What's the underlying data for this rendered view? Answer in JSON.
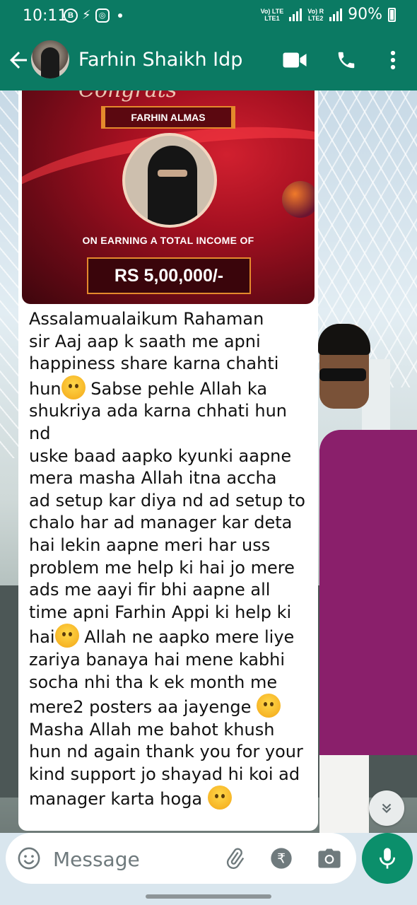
{
  "status_bar": {
    "time": "10:11",
    "net1_top": "Vo) LTE",
    "net1_bottom": "LTE1",
    "net2_top": "Vo) R",
    "net2_bottom": "LTE2",
    "battery": "90%"
  },
  "header": {
    "contact_name": "Farhin Shaikh Idp"
  },
  "message": {
    "poster": {
      "script_text": "Congrats",
      "name": "FARHIN ALMAS",
      "earning_label": "ON EARNING A TOTAL INCOME OF",
      "amount": "RS 5,00,000/-"
    },
    "lines": [
      "Assalamualaikum Rahaman",
      "sir Aaj aap k saath me apni",
      "happiness share karna chahti",
      "hun",
      " Sabse pehle Allah ka",
      "shukriya ada karna chhati hun nd",
      "uske baad aapko kyunki aapne",
      "mera masha Allah itna accha",
      "ad setup kar diya nd ad setup to",
      "chalo har ad manager kar deta",
      "hai lekin aapne meri har uss",
      "problem me help ki hai jo mere",
      "ads me aayi fir bhi aapne all",
      "time apni Farhin Appi ki help ki",
      "hai",
      " Allah ne aapko mere liye",
      "zariya banaya hai mene kabhi",
      "socha nhi tha k ek month me",
      "mere2 posters aa jayenge",
      "Masha Allah me bahot khush",
      "hun nd again thank you for your",
      "kind support jo shayad hi koi ad",
      "manager karta hoga"
    ]
  },
  "composer": {
    "placeholder": "Message"
  },
  "icons": {
    "back": "arrow-left-icon",
    "video": "video-call-icon",
    "call": "phone-icon",
    "menu": "more-vert-icon",
    "emoji": "emoji-icon",
    "attach": "paperclip-icon",
    "payment": "rupee-icon",
    "camera": "camera-icon",
    "mic": "mic-icon",
    "scroll": "chevron-double-down-icon"
  },
  "colors": {
    "header": "#0b7a63",
    "mic": "#0b8f6b",
    "bubble": "#ffffff"
  }
}
